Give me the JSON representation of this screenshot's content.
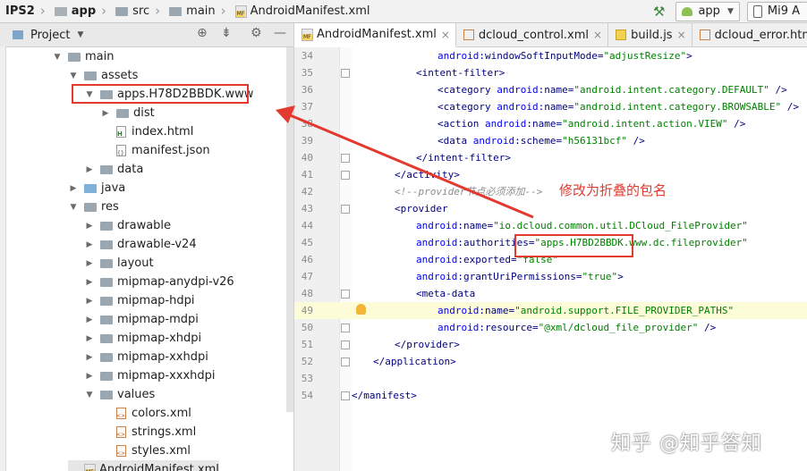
{
  "navbar": {
    "crumbs": [
      "IPS2",
      "app",
      "src",
      "main",
      "AndroidManifest.xml"
    ],
    "run_config": "app",
    "device": "Mi9 A"
  },
  "project_panel": {
    "title": "Project",
    "tree": [
      {
        "label": "main",
        "arrow": "▼",
        "icon": "folder"
      },
      {
        "label": "assets",
        "arrow": "▼",
        "icon": "folder"
      },
      {
        "label": "apps.H78D2BBDK.www",
        "arrow": "▼",
        "icon": "folder"
      },
      {
        "label": "dist",
        "arrow": "▶",
        "icon": "folder"
      },
      {
        "label": "index.html",
        "arrow": "",
        "icon": "html"
      },
      {
        "label": "manifest.json",
        "arrow": "",
        "icon": "json"
      },
      {
        "label": "data",
        "arrow": "▶",
        "icon": "folder"
      },
      {
        "label": "java",
        "arrow": "▶",
        "icon": "folder-blue"
      },
      {
        "label": "res",
        "arrow": "▼",
        "icon": "folder"
      },
      {
        "label": "drawable",
        "arrow": "▶",
        "icon": "folder"
      },
      {
        "label": "drawable-v24",
        "arrow": "▶",
        "icon": "folder"
      },
      {
        "label": "layout",
        "arrow": "▶",
        "icon": "folder"
      },
      {
        "label": "mipmap-anydpi-v26",
        "arrow": "▶",
        "icon": "folder"
      },
      {
        "label": "mipmap-hdpi",
        "arrow": "▶",
        "icon": "folder"
      },
      {
        "label": "mipmap-mdpi",
        "arrow": "▶",
        "icon": "folder"
      },
      {
        "label": "mipmap-xhdpi",
        "arrow": "▶",
        "icon": "folder"
      },
      {
        "label": "mipmap-xxhdpi",
        "arrow": "▶",
        "icon": "folder"
      },
      {
        "label": "mipmap-xxxhdpi",
        "arrow": "▶",
        "icon": "folder"
      },
      {
        "label": "values",
        "arrow": "▼",
        "icon": "folder"
      },
      {
        "label": "colors.xml",
        "arrow": "",
        "icon": "xml"
      },
      {
        "label": "strings.xml",
        "arrow": "",
        "icon": "xml"
      },
      {
        "label": "styles.xml",
        "arrow": "",
        "icon": "xml"
      },
      {
        "label": "AndroidManifest.xml",
        "arrow": "",
        "icon": "manifest"
      }
    ]
  },
  "editor": {
    "tabs": [
      {
        "label": "AndroidManifest.xml",
        "active": true,
        "icon": "manifest"
      },
      {
        "label": "dcloud_control.xml",
        "active": false,
        "icon": "xml"
      },
      {
        "label": "build.js",
        "active": false,
        "icon": "js"
      },
      {
        "label": "dcloud_error.html",
        "active": false,
        "icon": "html"
      }
    ],
    "lines": [
      {
        "n": "34",
        "indent": 3,
        "parts": [
          [
            "attr",
            "android"
          ],
          [
            "tag",
            ":windowSoftInputMode"
          ],
          [
            "tag",
            "="
          ],
          [
            "val",
            "\"adjustResize\""
          ],
          [
            "tag",
            ">"
          ]
        ]
      },
      {
        "n": "35",
        "indent": 2,
        "parts": [
          [
            "tag",
            "<intent-filter"
          ],
          [
            "tag",
            ">"
          ]
        ],
        "fold": true
      },
      {
        "n": "36",
        "indent": 3,
        "parts": [
          [
            "tag",
            "<category "
          ],
          [
            "attr",
            "android"
          ],
          [
            "tag",
            ":name"
          ],
          [
            "tag",
            "="
          ],
          [
            "val",
            "\"android.intent.category.DEFAULT\""
          ],
          [
            "tag",
            " />"
          ]
        ]
      },
      {
        "n": "37",
        "indent": 3,
        "parts": [
          [
            "tag",
            "<category "
          ],
          [
            "attr",
            "android"
          ],
          [
            "tag",
            ":name"
          ],
          [
            "tag",
            "="
          ],
          [
            "val",
            "\"android.intent.category.BROWSABLE\""
          ],
          [
            "tag",
            " />"
          ]
        ]
      },
      {
        "n": "38",
        "indent": 3,
        "parts": [
          [
            "tag",
            "<action "
          ],
          [
            "attr",
            "android"
          ],
          [
            "tag",
            ":name"
          ],
          [
            "tag",
            "="
          ],
          [
            "val",
            "\"android.intent.action.VIEW\""
          ],
          [
            "tag",
            " />"
          ]
        ]
      },
      {
        "n": "39",
        "indent": 3,
        "parts": [
          [
            "tag",
            "<data "
          ],
          [
            "attr",
            "android"
          ],
          [
            "tag",
            ":scheme"
          ],
          [
            "tag",
            "="
          ],
          [
            "val",
            "\"h56131bcf\""
          ],
          [
            "tag",
            " />"
          ]
        ]
      },
      {
        "n": "40",
        "indent": 2,
        "parts": [
          [
            "tag",
            "</intent-filter>"
          ]
        ],
        "fold": true
      },
      {
        "n": "41",
        "indent": 1,
        "parts": [
          [
            "tag",
            "</activity>"
          ]
        ],
        "fold": true
      },
      {
        "n": "42",
        "indent": 1,
        "parts": [
          [
            "cmt",
            "<!--provider节点必须添加-->"
          ]
        ]
      },
      {
        "n": "43",
        "indent": 1,
        "parts": [
          [
            "tag",
            "<provider"
          ]
        ],
        "fold": true
      },
      {
        "n": "44",
        "indent": 2,
        "parts": [
          [
            "attr",
            "android"
          ],
          [
            "tag",
            ":name"
          ],
          [
            "tag",
            "="
          ],
          [
            "val",
            "\"io.dcloud.common.util.DCloud_FileProvider\""
          ]
        ]
      },
      {
        "n": "45",
        "indent": 2,
        "parts": [
          [
            "attr",
            "android"
          ],
          [
            "tag",
            ":authorities"
          ],
          [
            "tag",
            "="
          ],
          [
            "val",
            "\"apps.H7BD2BBDK.www.dc.fileprovider\""
          ]
        ]
      },
      {
        "n": "46",
        "indent": 2,
        "parts": [
          [
            "attr",
            "android"
          ],
          [
            "tag",
            ":exported"
          ],
          [
            "tag",
            "="
          ],
          [
            "val",
            "\"false\""
          ]
        ]
      },
      {
        "n": "47",
        "indent": 2,
        "parts": [
          [
            "attr",
            "android"
          ],
          [
            "tag",
            ":grantUriPermissions"
          ],
          [
            "tag",
            "="
          ],
          [
            "val",
            "\"true\""
          ],
          [
            "tag",
            ">"
          ]
        ]
      },
      {
        "n": "48",
        "indent": 2,
        "parts": [
          [
            "tag",
            "<meta-data"
          ]
        ],
        "fold": true
      },
      {
        "n": "49",
        "indent": 3,
        "parts": [
          [
            "attr",
            "android"
          ],
          [
            "tag",
            ":name"
          ],
          [
            "tag",
            "="
          ],
          [
            "val",
            "\"android.support.FILE_PROVIDER_PATHS\""
          ]
        ],
        "highlight": true,
        "bulb": true
      },
      {
        "n": "50",
        "indent": 3,
        "parts": [
          [
            "attr",
            "android"
          ],
          [
            "tag",
            ":resource"
          ],
          [
            "tag",
            "="
          ],
          [
            "val",
            "\"@xml/dcloud_file_provider\""
          ],
          [
            "tag",
            " />"
          ]
        ],
        "fold": true
      },
      {
        "n": "51",
        "indent": 1,
        "parts": [
          [
            "tag",
            "</provider>"
          ]
        ],
        "fold": true
      },
      {
        "n": "52",
        "indent": 0,
        "parts": [
          [
            "tag",
            "</application>"
          ]
        ],
        "fold": true
      },
      {
        "n": "53",
        "indent": 0,
        "parts": []
      },
      {
        "n": "54",
        "indent": -1,
        "parts": [
          [
            "tag",
            "</manifest>"
          ]
        ],
        "fold": true
      }
    ]
  },
  "annotation": {
    "text": "修改为折叠的包名",
    "color": "#e23a2e"
  },
  "watermark": "知乎 @知乎答知"
}
